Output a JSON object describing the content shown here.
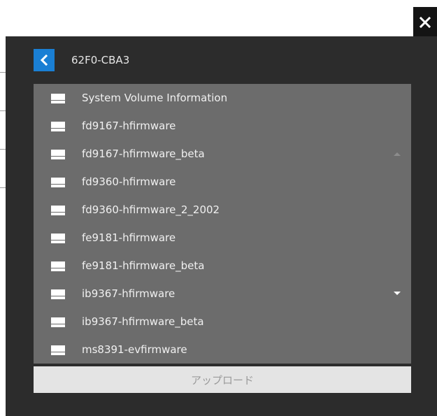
{
  "dialog": {
    "title": "62F0-CBA3",
    "close_icon": "close-icon",
    "back_icon": "chevron-left-icon",
    "upload_label": "アップロード",
    "accent_color": "#1a7fd4"
  },
  "files": [
    {
      "label": "System Volume Information",
      "icon": "drive-icon"
    },
    {
      "label": "fd9167-hfirmware",
      "icon": "drive-icon"
    },
    {
      "label": "fd9167-hfirmware_beta",
      "icon": "drive-icon"
    },
    {
      "label": "fd9360-hfirmware",
      "icon": "drive-icon"
    },
    {
      "label": "fd9360-hfirmware_2_2002",
      "icon": "drive-icon"
    },
    {
      "label": "fe9181-hfirmware",
      "icon": "drive-icon"
    },
    {
      "label": "fe9181-hfirmware_beta",
      "icon": "drive-icon"
    },
    {
      "label": "ib9367-hfirmware",
      "icon": "drive-icon"
    },
    {
      "label": "ib9367-hfirmware_beta",
      "icon": "drive-icon"
    },
    {
      "label": "ms8391-evfirmware",
      "icon": "drive-icon"
    }
  ]
}
